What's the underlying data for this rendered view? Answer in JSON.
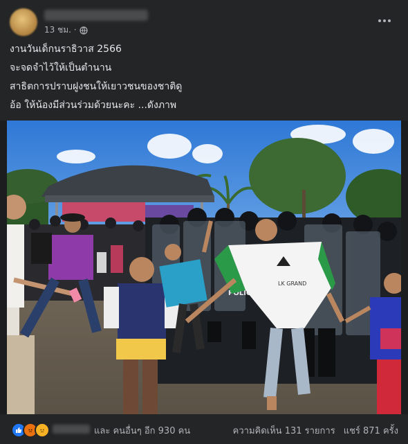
{
  "post": {
    "timestamp": "13 ชม. ·",
    "text_lines": [
      "งานวันเด็กนราธิวาส 2566",
      "จะจดจำไว้ให้เป็นตำนาน",
      "สาธิตการปราบฝูงชนให้เยาวชนของชาติดู",
      "อ้อ ให้น้องมีส่วนร่วมด้วยนะคะ ...ดังภาพ"
    ],
    "photo": {
      "police_shield_text": "POLICE",
      "shirt_text": "LK GRAND"
    }
  },
  "footer": {
    "reaction_icons": [
      "like-icon",
      "angry-icon",
      "sad-icon"
    ],
    "reactions_label": "และ คนอื่นๆ อีก 930 คน",
    "comments_label": "ความคิดเห็น 131 รายการ",
    "shares_label": "แชร์ 871 ครั้ง"
  },
  "colors": {
    "background": "#242526",
    "text": "#e4e6eb",
    "secondary_text": "#b0b3b8",
    "like": "#2078f4"
  }
}
